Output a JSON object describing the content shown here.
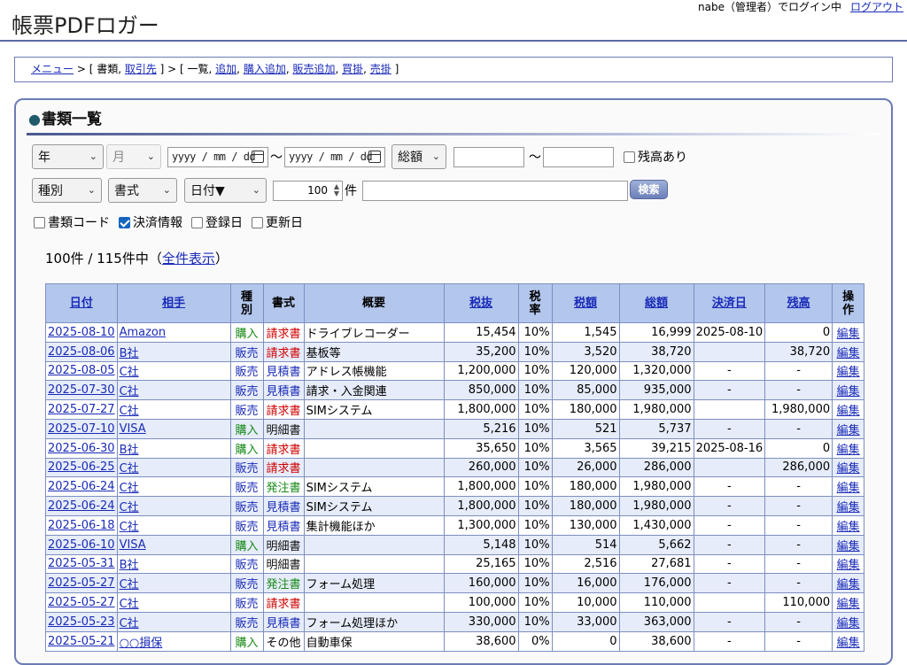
{
  "header": {
    "user_status": "nabe（管理者）でログイン中",
    "logout": "ログアウト",
    "app_title": "帳票PDFロガー"
  },
  "breadcrumb": {
    "menu": "メニュー",
    "sep1": " > [ 書類, ",
    "clients": "取引先",
    "sep2": " ] > [ 一覧, ",
    "add": "追加",
    "comma1": ", ",
    "purchase_add": "購入追加",
    "comma2": ", ",
    "sale_add": "販売追加",
    "comma3": ", ",
    "payable": "買掛",
    "comma4": ", ",
    "receivable": "売掛",
    "end": " ]"
  },
  "panel": {
    "title": "書類一覧"
  },
  "filters": {
    "year": "年",
    "month": "月",
    "date_from": "yyyy / mm / dd",
    "tilde": "〜",
    "date_to": "yyyy / mm / dd",
    "amount_type": "総額",
    "balance_only": "残高あり",
    "type": "種別",
    "format": "書式",
    "sort": "日付▼",
    "limit": "100",
    "limit_unit": "件",
    "search": "検索",
    "show_code": "書類コード",
    "show_payment": "決済情報",
    "show_created": "登録日",
    "show_updated": "更新日"
  },
  "summary": {
    "count_text": "100件 / 115件中（",
    "show_all": "全件表示",
    "close": "）"
  },
  "table": {
    "headers": {
      "date": "日付",
      "partner": "相手",
      "type": "種\n別",
      "format": "書式",
      "summary": "概要",
      "pretax": "税抜",
      "taxrate": "税\n率",
      "tax": "税額",
      "total": "総額",
      "paydate": "決済日",
      "balance": "残高",
      "ops": "操\n作"
    },
    "edit": "編集",
    "rows": [
      {
        "date": "2025-08-10",
        "partner": "Amazon",
        "type": "購入",
        "format": "請求書",
        "summary": "ドライブレコーダー",
        "pretax": "15,454",
        "rate": "10%",
        "tax": "1,545",
        "total": "16,999",
        "paydate": "2025-08-10",
        "balance": "0"
      },
      {
        "date": "2025-08-06",
        "partner": "B社",
        "type": "販売",
        "format": "請求書",
        "summary": "基板等",
        "pretax": "35,200",
        "rate": "10%",
        "tax": "3,520",
        "total": "38,720",
        "paydate": "",
        "balance": "38,720"
      },
      {
        "date": "2025-08-05",
        "partner": "C社",
        "type": "販売",
        "format": "見積書",
        "summary": "アドレス帳機能",
        "pretax": "1,200,000",
        "rate": "10%",
        "tax": "120,000",
        "total": "1,320,000",
        "paydate": "-",
        "balance": "-"
      },
      {
        "date": "2025-07-30",
        "partner": "C社",
        "type": "販売",
        "format": "見積書",
        "summary": "請求・入金関連",
        "pretax": "850,000",
        "rate": "10%",
        "tax": "85,000",
        "total": "935,000",
        "paydate": "-",
        "balance": "-"
      },
      {
        "date": "2025-07-27",
        "partner": "C社",
        "type": "販売",
        "format": "請求書",
        "summary": "SIMシステム",
        "pretax": "1,800,000",
        "rate": "10%",
        "tax": "180,000",
        "total": "1,980,000",
        "paydate": "",
        "balance": "1,980,000"
      },
      {
        "date": "2025-07-10",
        "partner": "VISA",
        "type": "購入",
        "format": "明細書",
        "summary": "",
        "pretax": "5,216",
        "rate": "10%",
        "tax": "521",
        "total": "5,737",
        "paydate": "-",
        "balance": "-"
      },
      {
        "date": "2025-06-30",
        "partner": "B社",
        "type": "購入",
        "format": "請求書",
        "summary": "",
        "pretax": "35,650",
        "rate": "10%",
        "tax": "3,565",
        "total": "39,215",
        "paydate": "2025-08-16",
        "balance": "0"
      },
      {
        "date": "2025-06-25",
        "partner": "C社",
        "type": "販売",
        "format": "請求書",
        "summary": "",
        "pretax": "260,000",
        "rate": "10%",
        "tax": "26,000",
        "total": "286,000",
        "paydate": "",
        "balance": "286,000"
      },
      {
        "date": "2025-06-24",
        "partner": "C社",
        "type": "販売",
        "format": "発注書",
        "summary": "SIMシステム",
        "pretax": "1,800,000",
        "rate": "10%",
        "tax": "180,000",
        "total": "1,980,000",
        "paydate": "-",
        "balance": "-"
      },
      {
        "date": "2025-06-24",
        "partner": "C社",
        "type": "販売",
        "format": "見積書",
        "summary": "SIMシステム",
        "pretax": "1,800,000",
        "rate": "10%",
        "tax": "180,000",
        "total": "1,980,000",
        "paydate": "-",
        "balance": "-"
      },
      {
        "date": "2025-06-18",
        "partner": "C社",
        "type": "販売",
        "format": "見積書",
        "summary": "集計機能ほか",
        "pretax": "1,300,000",
        "rate": "10%",
        "tax": "130,000",
        "total": "1,430,000",
        "paydate": "-",
        "balance": "-"
      },
      {
        "date": "2025-06-10",
        "partner": "VISA",
        "type": "購入",
        "format": "明細書",
        "summary": "",
        "pretax": "5,148",
        "rate": "10%",
        "tax": "514",
        "total": "5,662",
        "paydate": "-",
        "balance": "-"
      },
      {
        "date": "2025-05-31",
        "partner": "B社",
        "type": "販売",
        "format": "明細書",
        "summary": "",
        "pretax": "25,165",
        "rate": "10%",
        "tax": "2,516",
        "total": "27,681",
        "paydate": "-",
        "balance": "-"
      },
      {
        "date": "2025-05-27",
        "partner": "C社",
        "type": "販売",
        "format": "発注書",
        "summary": "フォーム処理",
        "pretax": "160,000",
        "rate": "10%",
        "tax": "16,000",
        "total": "176,000",
        "paydate": "-",
        "balance": "-"
      },
      {
        "date": "2025-05-27",
        "partner": "C社",
        "type": "販売",
        "format": "請求書",
        "summary": "",
        "pretax": "100,000",
        "rate": "10%",
        "tax": "10,000",
        "total": "110,000",
        "paydate": "",
        "balance": "110,000"
      },
      {
        "date": "2025-05-23",
        "partner": "C社",
        "type": "販売",
        "format": "見積書",
        "summary": "フォーム処理ほか",
        "pretax": "330,000",
        "rate": "10%",
        "tax": "33,000",
        "total": "363,000",
        "paydate": "-",
        "balance": "-"
      },
      {
        "date": "2025-05-21",
        "partner": "○○損保",
        "type": "購入",
        "format": "その他",
        "summary": "自動車保",
        "pretax": "38,600",
        "rate": "0%",
        "tax": "0",
        "total": "38,600",
        "paydate": "-",
        "balance": "-"
      }
    ]
  },
  "colors": {
    "header_bg": "#b3c6ec",
    "row_alt": "#e6ecf9",
    "buy": "#178a17",
    "sell": "#1a2bb8",
    "invoice": "#d00000",
    "order": "#178a17"
  }
}
